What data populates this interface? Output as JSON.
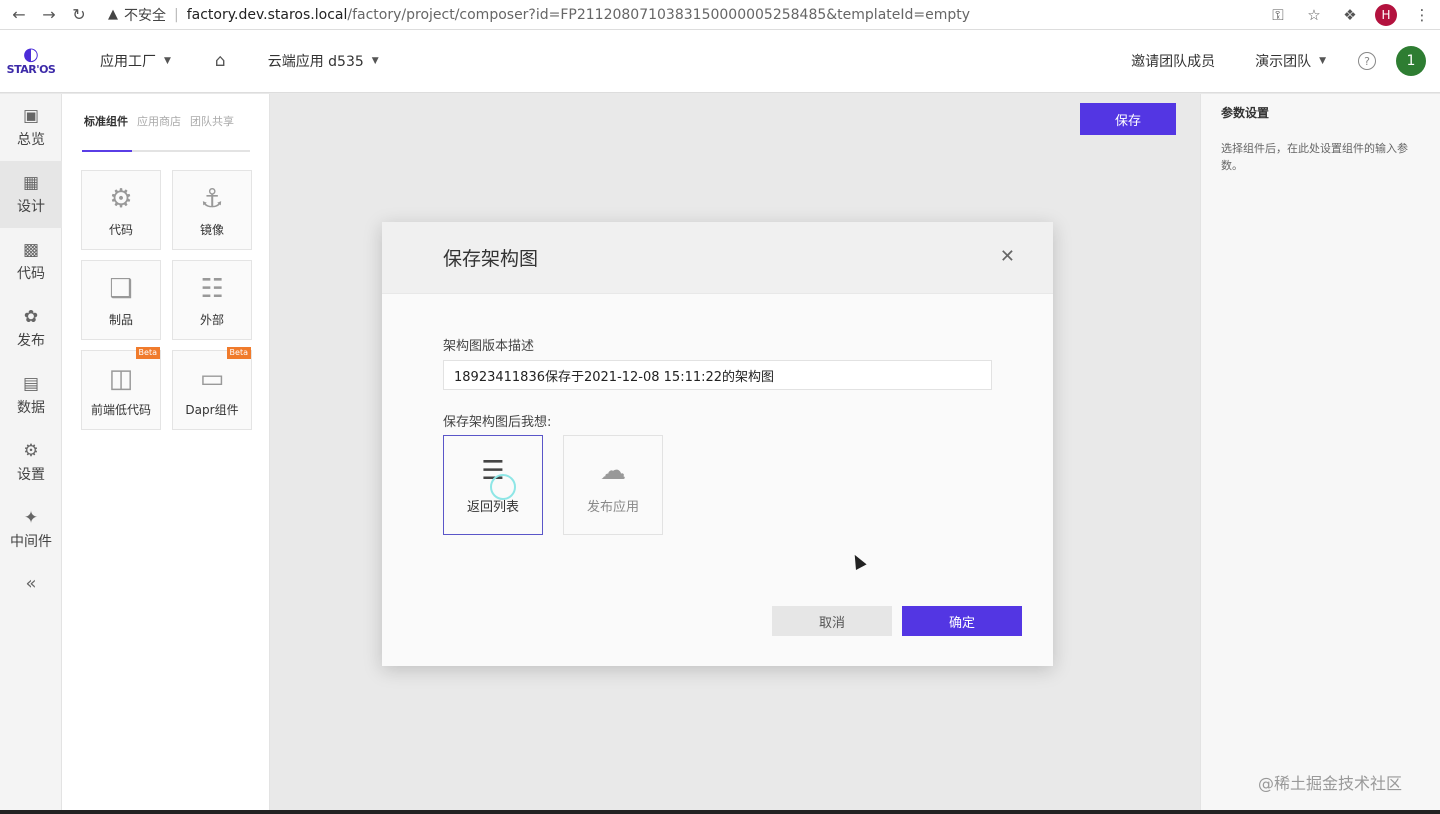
{
  "browser": {
    "insecure_label": "不安全",
    "url_host": "factory.dev.staros.local",
    "url_path": "/factory/project/composer?id=FP21120807103831500000052584​85&templateId=empty",
    "profile_initial": "H"
  },
  "header": {
    "logo_text": "STAR'OS",
    "factory_menu": "应用工厂",
    "app_menu": "云端应用 d535",
    "invite": "邀请团队成员",
    "team_menu": "演示团队",
    "avatar_initial": "1"
  },
  "sidebar": {
    "items": [
      {
        "label": "总览",
        "icon": "monitor-icon"
      },
      {
        "label": "设计",
        "icon": "design-icon"
      },
      {
        "label": "代码",
        "icon": "code-icon"
      },
      {
        "label": "发布",
        "icon": "release-icon"
      },
      {
        "label": "数据",
        "icon": "data-icon"
      },
      {
        "label": "设置",
        "icon": "gear-icon"
      },
      {
        "label": "中间件",
        "icon": "puzzle-icon"
      }
    ]
  },
  "components": {
    "tabs": [
      "标准组件",
      "应用商店",
      "团队共享"
    ],
    "cards": [
      {
        "label": "代码",
        "icon": "robot-arm-icon"
      },
      {
        "label": "镜像",
        "icon": "docker-icon"
      },
      {
        "label": "制品",
        "icon": "package-icon"
      },
      {
        "label": "外部",
        "icon": "network-icon"
      },
      {
        "label": "前端低代码",
        "icon": "lowcode-icon",
        "badge": "Beta"
      },
      {
        "label": "Dapr组件",
        "icon": "dapr-icon",
        "badge": "Beta"
      }
    ]
  },
  "toolbar": {
    "save_label": "保存"
  },
  "right_panel": {
    "title": "参数设置",
    "text": "选择组件后，在此处设置组件的输入参数。"
  },
  "modal": {
    "title": "保存架构图",
    "desc_label": "架构图版本描述",
    "desc_value": "18923411836保存于2021-12-08 15:11:22的架构图",
    "after_label": "保存架构图后我想:",
    "options": [
      {
        "label": "返回列表",
        "icon": "list-icon",
        "selected": true
      },
      {
        "label": "发布应用",
        "icon": "cloud-upload-icon",
        "selected": false
      }
    ],
    "cancel_label": "取消",
    "ok_label": "确定"
  },
  "watermark": "@稀土掘金技术社区",
  "colors": {
    "accent": "#5336e3",
    "beta": "#f07b2c",
    "avatar": "#2e7d32"
  }
}
